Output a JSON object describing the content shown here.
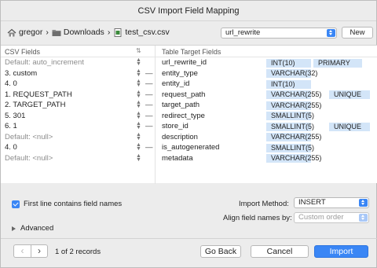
{
  "window": {
    "title": "CSV Import Field Mapping"
  },
  "breadcrumb": {
    "items": [
      {
        "label": "gregor",
        "icon": "home-icon"
      },
      {
        "label": "Downloads",
        "icon": "folder-icon"
      },
      {
        "label": "test_csv.csv",
        "icon": "csv-file-icon"
      }
    ]
  },
  "table_select": {
    "value": "url_rewrite"
  },
  "new_button": {
    "label": "New"
  },
  "grid": {
    "header_csv": "CSV Fields",
    "header_target": "Table Target Fields",
    "rows": [
      {
        "csv": "Default: auto_increment",
        "csv_muted": true,
        "dash": "",
        "target": "url_rewrite_id",
        "type": "INT(10)",
        "key": "PRIMARY"
      },
      {
        "csv": "3. custom",
        "csv_muted": false,
        "dash": "—",
        "target": "entity_type",
        "type": "VARCHAR(32)",
        "key": ""
      },
      {
        "csv": "4. 0",
        "csv_muted": false,
        "dash": "—",
        "target": "entity_id",
        "type": "INT(10)",
        "key": ""
      },
      {
        "csv": "1. REQUEST_PATH",
        "csv_muted": false,
        "dash": "—",
        "target": "request_path",
        "type": "VARCHAR(255)",
        "key": "UNIQUE"
      },
      {
        "csv": "2. TARGET_PATH",
        "csv_muted": false,
        "dash": "—",
        "target": "target_path",
        "type": "VARCHAR(255)",
        "key": ""
      },
      {
        "csv": "5. 301",
        "csv_muted": false,
        "dash": "—",
        "target": "redirect_type",
        "type": "SMALLINT(5)",
        "key": ""
      },
      {
        "csv": "6. 1",
        "csv_muted": false,
        "dash": "—",
        "target": "store_id",
        "type": "SMALLINT(5)",
        "key": "UNIQUE"
      },
      {
        "csv": "Default: <null>",
        "csv_muted": true,
        "dash": "",
        "target": "description",
        "type": "VARCHAR(255)",
        "key": ""
      },
      {
        "csv": "4. 0",
        "csv_muted": false,
        "dash": "—",
        "target": "is_autogenerated",
        "type": "SMALLINT(5)",
        "key": ""
      },
      {
        "csv": "Default: <null>",
        "csv_muted": true,
        "dash": "",
        "target": "metadata",
        "type": "VARCHAR(255)",
        "key": ""
      }
    ]
  },
  "options": {
    "first_line_label": "First line contains field names",
    "first_line_checked": true,
    "import_method_label": "Import Method:",
    "import_method_value": "INSERT",
    "align_label": "Align field names by:",
    "align_value": "Custom order",
    "advanced_label": "Advanced"
  },
  "footer": {
    "records": "1 of 2 records",
    "prev_glyph": "‹",
    "next_glyph": "›",
    "go_back": "Go Back",
    "cancel": "Cancel",
    "import": "Import"
  }
}
